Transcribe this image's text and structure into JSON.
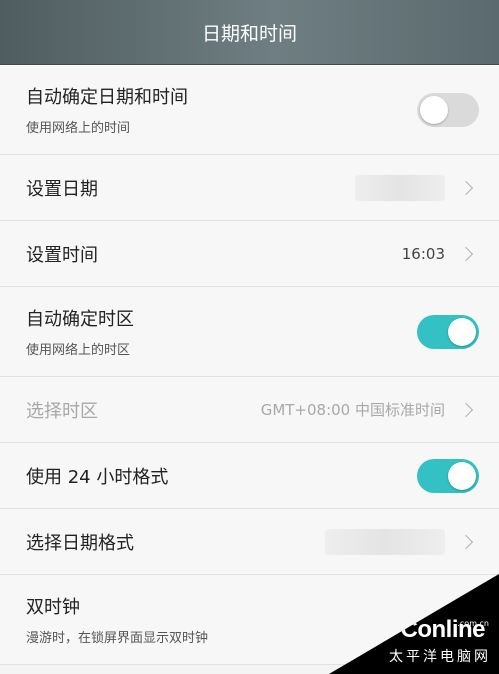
{
  "header": {
    "title": "日期和时间"
  },
  "rows": [
    {
      "title": "自动确定日期和时间",
      "subtitle": "使用网络上的时间",
      "toggle": false
    },
    {
      "title": "设置日期"
    },
    {
      "title": "设置时间",
      "value": "16:03"
    },
    {
      "title": "自动确定时区",
      "subtitle": "使用网络上的时区",
      "toggle": true
    },
    {
      "title": "选择时区",
      "value": "GMT+08:00 中国标准时间",
      "disabled": true
    },
    {
      "title": "使用 24 小时格式",
      "toggle": true
    },
    {
      "title": "选择日期格式"
    },
    {
      "title": "双时钟",
      "subtitle": "漫游时，在锁屏界面显示双时钟"
    }
  ],
  "watermark": {
    "logo": "PConline",
    "domain": ".com.cn",
    "subtitle": "太平洋电脑网"
  },
  "colors": {
    "accent": "#33c1c4",
    "header": "#5b6a6e"
  }
}
